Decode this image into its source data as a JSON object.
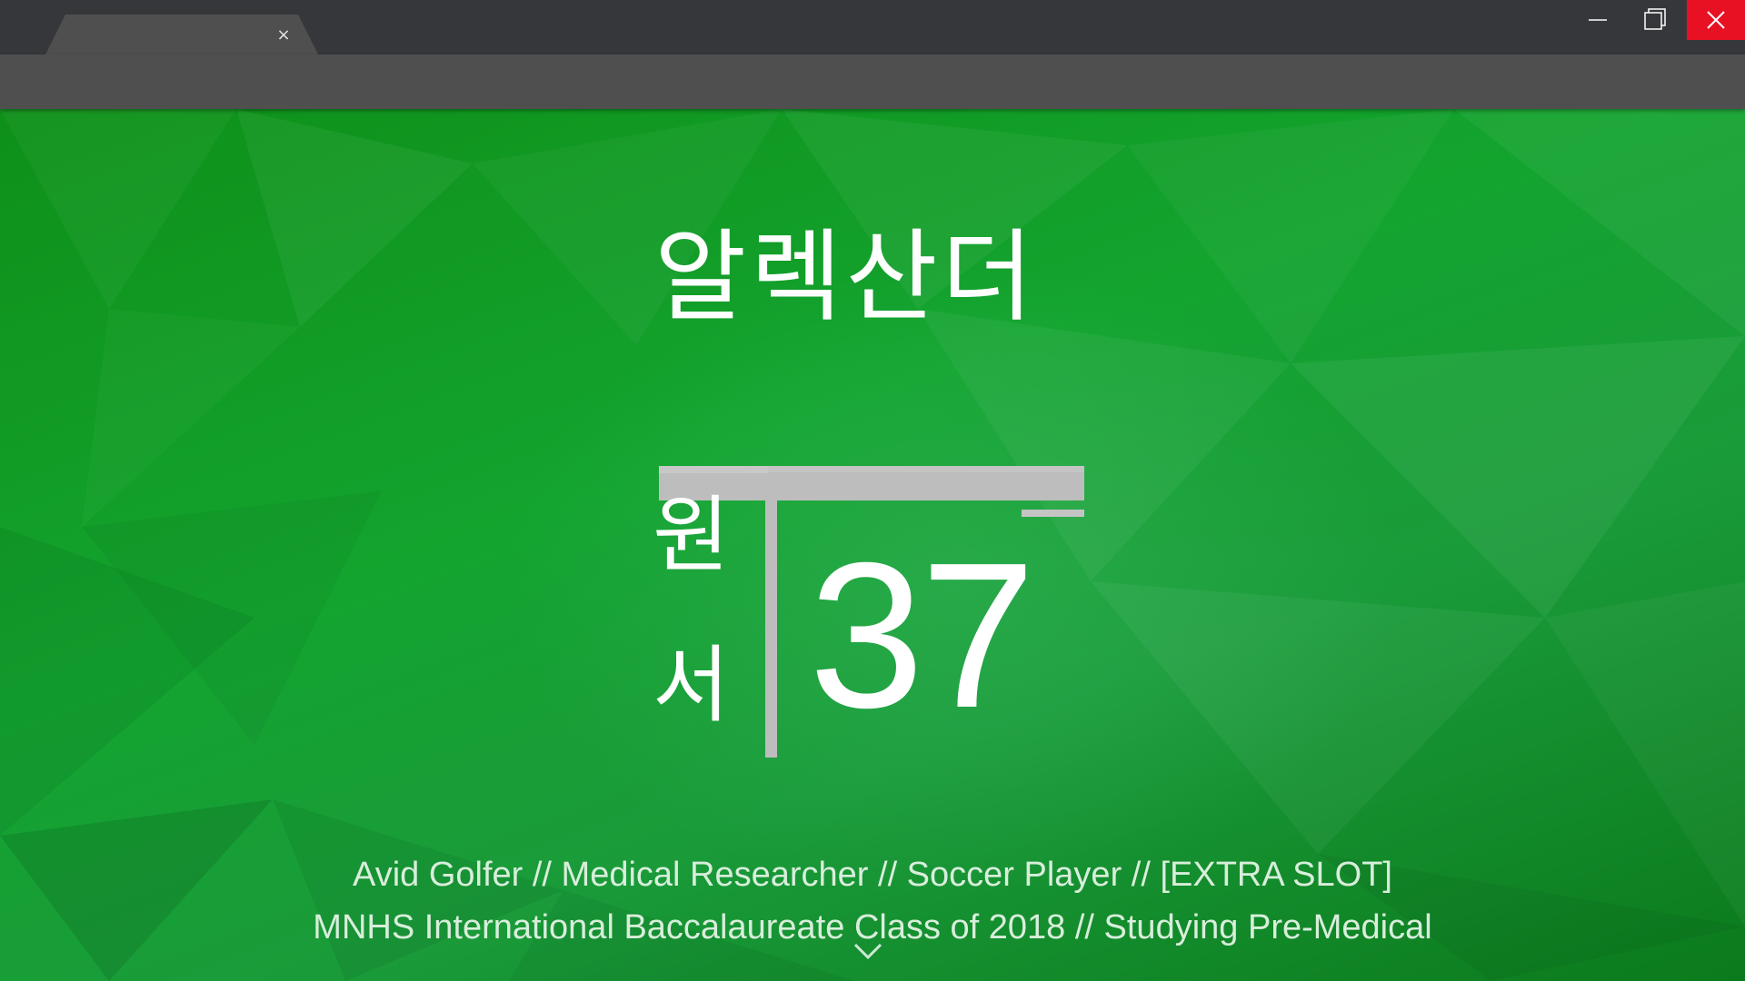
{
  "browser": {
    "tab": {
      "title": "",
      "close_glyph": "×"
    },
    "window_controls": {
      "minimize_icon": "minimize-icon",
      "maximize_icon": "restore-icon",
      "close_icon": "close-icon",
      "close_color": "#e81123"
    }
  },
  "hero": {
    "name_korean_top": "알렉산더",
    "name_korean_side_1": "원",
    "name_korean_side_2": "서",
    "number": "37",
    "tagline_1": "Avid Golfer // Medical Researcher // Soccer Player // [EXTRA SLOT]",
    "tagline_2": "MNHS International Baccalaureate Class of 2018 // Studying Pre-Medical",
    "scroll_icon": "chevron-down-icon"
  },
  "colors": {
    "background_green": "#13a42f",
    "accent_gray": "#bdbdbd",
    "chrome_dark": "#35373a",
    "chrome_bar": "#4f4f4f"
  }
}
